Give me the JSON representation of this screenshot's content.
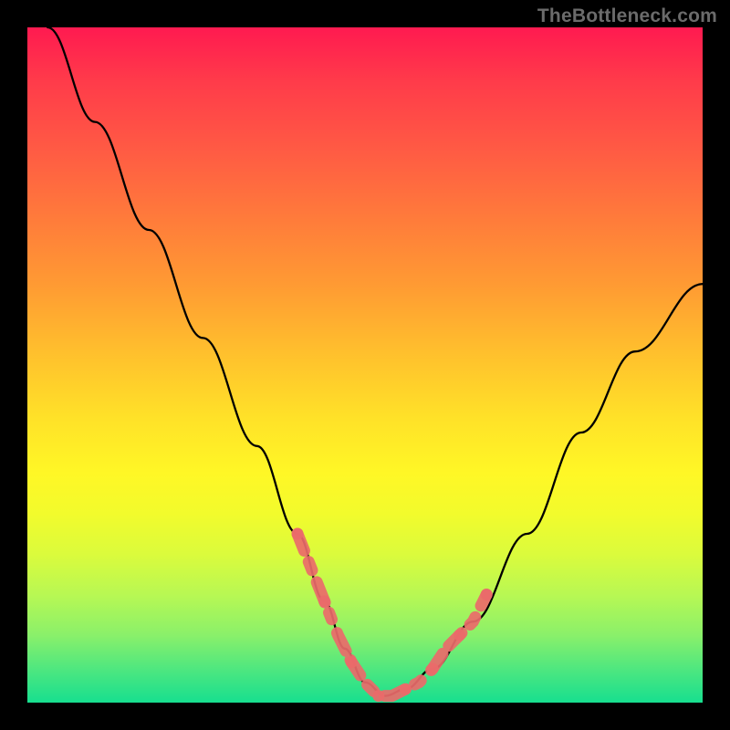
{
  "watermark": "TheBottleneck.com",
  "chart_data": {
    "type": "line",
    "title": "",
    "xlabel": "",
    "ylabel": "",
    "xlim": [
      0,
      100
    ],
    "ylim": [
      0,
      100
    ],
    "grid": false,
    "legend": false,
    "series": [
      {
        "name": "main-curve",
        "color": "#000000",
        "x": [
          3,
          10,
          18,
          26,
          34,
          40,
          44,
          47,
          50,
          53,
          56,
          60,
          66,
          74,
          82,
          90,
          100
        ],
        "y": [
          100,
          86,
          70,
          54,
          38,
          25,
          15,
          8,
          3,
          1,
          2,
          5,
          12,
          25,
          40,
          52,
          62
        ]
      },
      {
        "name": "valley-highlight",
        "color": "#ea6a6a",
        "x": [
          40,
          42,
          44,
          46,
          48,
          50,
          52,
          54,
          56,
          58,
          60,
          62,
          64,
          66,
          68
        ],
        "y": [
          25,
          20,
          15,
          10,
          6,
          3,
          1,
          1,
          2,
          3,
          5,
          8,
          10,
          12,
          16
        ]
      }
    ],
    "notes": "Heatmap-style background gradient; y-values are percentage heights read from gradient bands; curve minimum sits in the green band (~1%)."
  }
}
